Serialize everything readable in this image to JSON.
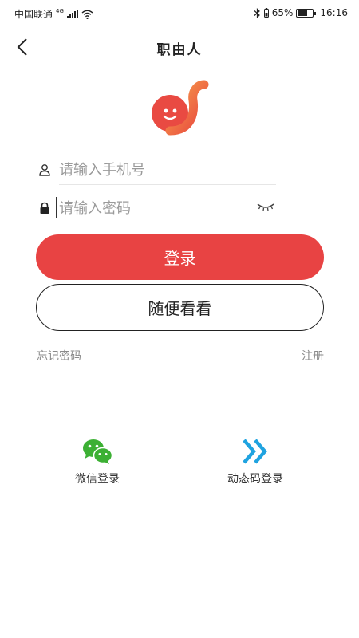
{
  "status_bar": {
    "carrier": "中国联通",
    "network_type": "4G",
    "battery_percent": "65%",
    "battery_level": 0.65,
    "time": "16:16"
  },
  "header": {
    "title": "职由人"
  },
  "form": {
    "phone_placeholder": "请输入手机号",
    "phone_value": "",
    "password_placeholder": "请输入密码",
    "password_value": ""
  },
  "buttons": {
    "login_label": "登录",
    "browse_label": "随便看看"
  },
  "links": {
    "forgot_password": "忘记密码",
    "register": "注册"
  },
  "alt_login": {
    "wechat_label": "微信登录",
    "sms_label": "动态码登录"
  },
  "colors": {
    "accent_red": "#e84343",
    "wechat_green": "#3cb034",
    "sms_blue": "#1fa3e0"
  }
}
